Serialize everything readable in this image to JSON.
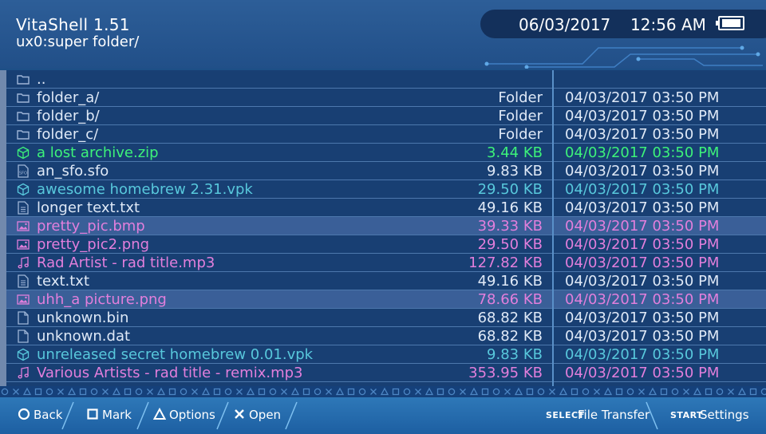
{
  "header": {
    "app_title": "VitaShell 1.51",
    "path": "ux0:super folder/",
    "date": "06/03/2017",
    "time": "12:56 AM"
  },
  "files": [
    {
      "name": "..",
      "size": "",
      "date": "",
      "icon": "folder-icon",
      "color": "white"
    },
    {
      "name": "folder_a/",
      "size": "Folder",
      "date": "04/03/2017 03:50 PM",
      "icon": "folder-icon",
      "color": "white"
    },
    {
      "name": "folder_b/",
      "size": "Folder",
      "date": "04/03/2017 03:50 PM",
      "icon": "folder-icon",
      "color": "white"
    },
    {
      "name": "folder_c/",
      "size": "Folder",
      "date": "04/03/2017 03:50 PM",
      "icon": "folder-icon",
      "color": "white"
    },
    {
      "name": "a lost archive.zip",
      "size": "3.44 KB",
      "date": "04/03/2017 03:50 PM",
      "icon": "archive-icon",
      "color": "green"
    },
    {
      "name": "an_sfo.sfo",
      "size": "9.83 KB",
      "date": "04/03/2017 03:50 PM",
      "icon": "sfo-icon",
      "color": "white"
    },
    {
      "name": "awesome homebrew 2.31.vpk",
      "size": "29.50 KB",
      "date": "04/03/2017 03:50 PM",
      "icon": "package-icon",
      "color": "cyan"
    },
    {
      "name": "longer text.txt",
      "size": "49.16 KB",
      "date": "04/03/2017 03:50 PM",
      "icon": "text-file-icon",
      "color": "white"
    },
    {
      "name": "pretty_pic.bmp",
      "size": "39.33 KB",
      "date": "04/03/2017 03:50 PM",
      "icon": "image-icon",
      "color": "pink",
      "selected": true
    },
    {
      "name": "pretty_pic2.png",
      "size": "29.50 KB",
      "date": "04/03/2017 03:50 PM",
      "icon": "image-icon",
      "color": "pink"
    },
    {
      "name": "Rad Artist - rad title.mp3",
      "size": "127.82 KB",
      "date": "04/03/2017 03:50 PM",
      "icon": "music-icon",
      "color": "pink"
    },
    {
      "name": "text.txt",
      "size": "49.16 KB",
      "date": "04/03/2017 03:50 PM",
      "icon": "text-file-icon",
      "color": "white"
    },
    {
      "name": "uhh_a picture.png",
      "size": "78.66 KB",
      "date": "04/03/2017 03:50 PM",
      "icon": "image-icon",
      "color": "pink",
      "selected": true
    },
    {
      "name": "unknown.bin",
      "size": "68.82 KB",
      "date": "04/03/2017 03:50 PM",
      "icon": "file-icon",
      "color": "white"
    },
    {
      "name": "unknown.dat",
      "size": "68.82 KB",
      "date": "04/03/2017 03:50 PM",
      "icon": "file-icon",
      "color": "white"
    },
    {
      "name": "unreleased secret homebrew 0.01.vpk",
      "size": "9.83 KB",
      "date": "04/03/2017 03:50 PM",
      "icon": "package-icon",
      "color": "cyan"
    },
    {
      "name": "Various Artists - rad title - remix.mp3",
      "size": "353.95 KB",
      "date": "04/03/2017 03:50 PM",
      "icon": "music-icon",
      "color": "pink"
    }
  ],
  "footer": {
    "back_label": "Back",
    "mark_label": "Mark",
    "options_label": "Options",
    "open_label": "Open",
    "select_key": "SELECT",
    "file_transfer_label": "File Transfer",
    "start_key": "START",
    "settings_label": "Settings"
  },
  "colors": {
    "background": "#1d4f86",
    "text_default": "#dfe9f7",
    "archive": "#3df27a",
    "package": "#58c8dc",
    "media": "#e27fdc",
    "selected_row": "#3a5f98"
  }
}
